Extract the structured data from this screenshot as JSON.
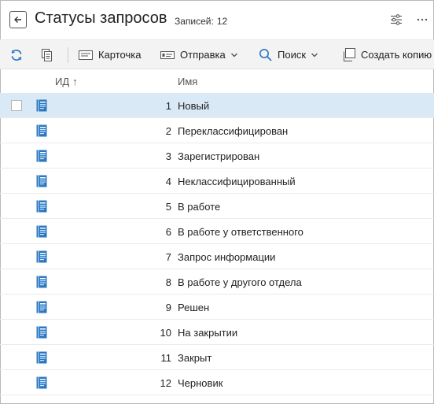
{
  "header": {
    "title": "Статусы запросов",
    "count_label": "Записей:",
    "count_value": "12"
  },
  "toolbar": {
    "card_label": "Карточка",
    "send_label": "Отправка",
    "search_label": "Поиск",
    "copy_label": "Создать копию"
  },
  "columns": {
    "id": "ИД",
    "name": "Имя"
  },
  "rows": [
    {
      "id": "1",
      "name": "Новый"
    },
    {
      "id": "2",
      "name": "Переклассифицирован"
    },
    {
      "id": "3",
      "name": "Зарегистрирован"
    },
    {
      "id": "4",
      "name": "Неклассифицированный"
    },
    {
      "id": "5",
      "name": "В работе"
    },
    {
      "id": "6",
      "name": "В работе у ответственного"
    },
    {
      "id": "7",
      "name": "Запрос информации"
    },
    {
      "id": "8",
      "name": "В работе у другого отдела"
    },
    {
      "id": "9",
      "name": "Решен"
    },
    {
      "id": "10",
      "name": "На закрытии"
    },
    {
      "id": "11",
      "name": "Закрыт"
    },
    {
      "id": "12",
      "name": "Черновик"
    }
  ],
  "colors": {
    "accent": "#2b78c2",
    "selected_row": "#dae9f6",
    "toolbar_bg": "#f3f3f3"
  }
}
